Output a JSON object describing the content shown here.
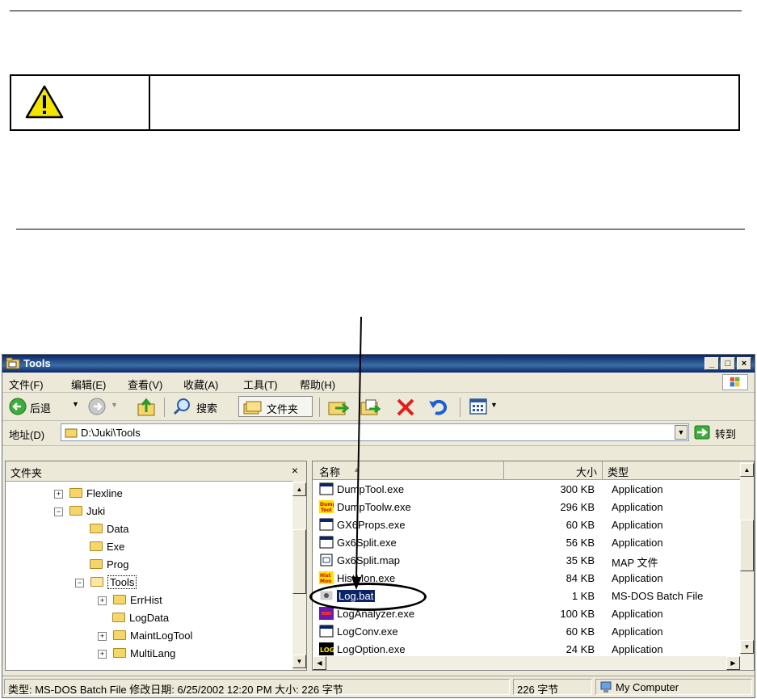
{
  "window": {
    "title": "Tools",
    "menu": [
      "文件(F)",
      "编辑(E)",
      "查看(V)",
      "收藏(A)",
      "工具(T)",
      "帮助(H)"
    ],
    "controls": [
      "_",
      "□",
      "×"
    ],
    "toolbar": {
      "back": "后退",
      "search": "搜索",
      "folders": "文件夹"
    },
    "address": {
      "label": "地址(D)",
      "value": "D:\\Juki\\Tools",
      "go": "转到"
    }
  },
  "left_pane": {
    "title": "文件夹",
    "close": "×",
    "tree": [
      {
        "label": "Flexline",
        "expander": "+"
      },
      {
        "label": "Juki",
        "expander": "−"
      },
      {
        "label": "Data",
        "expander": ""
      },
      {
        "label": "Exe",
        "expander": ""
      },
      {
        "label": "Prog",
        "expander": ""
      },
      {
        "label": "Tools",
        "expander": "−"
      },
      {
        "label": "ErrHist",
        "expander": "+"
      },
      {
        "label": "LogData",
        "expander": ""
      },
      {
        "label": "MaintLogTool",
        "expander": "+"
      },
      {
        "label": "MultiLang",
        "expander": "+"
      }
    ]
  },
  "right_pane": {
    "columns": {
      "name": "名称",
      "size": "大小",
      "type": "类型"
    },
    "files": [
      {
        "name": "DumpTool.exe",
        "size": "300 KB",
        "type": "Application",
        "icon": "app-window-icon"
      },
      {
        "name": "DumpToolw.exe",
        "size": "296 KB",
        "type": "Application",
        "icon": "dumptool-icon"
      },
      {
        "name": "GX6Props.exe",
        "size": "60 KB",
        "type": "Application",
        "icon": "app-window-icon"
      },
      {
        "name": "Gx6Split.exe",
        "size": "56 KB",
        "type": "Application",
        "icon": "app-window-icon"
      },
      {
        "name": "Gx6Split.map",
        "size": "35 KB",
        "type": "MAP 文件",
        "icon": "map-file-icon"
      },
      {
        "name": "HistMon.exe",
        "size": "84 KB",
        "type": "Application",
        "icon": "histmon-icon"
      },
      {
        "name": "Log.bat",
        "size": "1 KB",
        "type": "MS-DOS Batch File",
        "icon": "batch-file-icon",
        "selected": true
      },
      {
        "name": "LogAnalyzer.exe",
        "size": "100 KB",
        "type": "Application",
        "icon": "loganalyzer-icon"
      },
      {
        "name": "LogConv.exe",
        "size": "60 KB",
        "type": "Application",
        "icon": "app-window-icon"
      },
      {
        "name": "LogOption.exe",
        "size": "24 KB",
        "type": "Application",
        "icon": "logoption-icon"
      }
    ]
  },
  "status_bar": {
    "info": "类型: MS-DOS Batch File 修改日期: 6/25/2002 12:20 PM 大小: 226 字节",
    "size": "226 字节",
    "zone": "My Computer"
  },
  "colors": {
    "title_bar": "#0a246a",
    "selection": "#0a246a",
    "warning_yellow": "#f2e600"
  }
}
